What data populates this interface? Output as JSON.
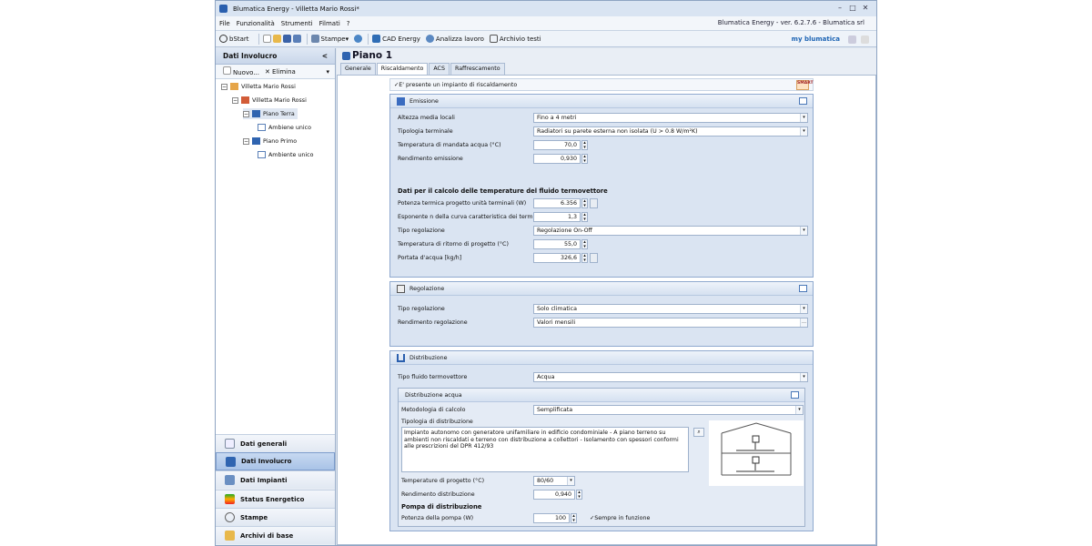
{
  "window": {
    "title": "Blumatica Energy - Villetta Mario Rossi*",
    "version": "Blumatica Energy - ver. 6.2.7.6 - Blumatica srl"
  },
  "menu": [
    "File",
    "Funzionalità",
    "Strumenti",
    "Filmati",
    "?"
  ],
  "toolbar": {
    "bstart": "bStart",
    "stampe": "Stampe",
    "cad": "CAD Energy",
    "analizza": "Analizza lavoro",
    "archivio": "Archivio testi",
    "brand": "my blumatica"
  },
  "left": {
    "header": "Dati Involucro",
    "collapse": "<",
    "nuovo": "Nuovo...",
    "elimina": "Elimina",
    "tree": [
      "Villetta Mario Rossi",
      "Villetta Mario Rossi",
      "Piano Terra",
      "Ambiene unico",
      "Piano Primo",
      "Ambiente unico"
    ],
    "nav": [
      "Dati generali",
      "Dati Involucro",
      "Dati Impianti",
      "Status Energetico",
      "Stampe",
      "Archivi di base"
    ]
  },
  "main": {
    "title": "Piano 1",
    "tabs": [
      "Generale",
      "Riscaldamento",
      "ACS",
      "Raffrescamento"
    ],
    "impianto_check": "E' presente un impianto di riscaldamento",
    "smart": "SMART",
    "emissione": {
      "title": "Emissione",
      "rows": [
        {
          "label": "Altezza media locali",
          "value": "Fino a 4 metri"
        },
        {
          "label": "Tipologia terminale",
          "value": "Radiatori su parete esterna non isolata (U > 0.8 W/m²K)"
        },
        {
          "label": "Temperatura di mandata acqua (°C)",
          "value": "70,0"
        },
        {
          "label": "Rendimento emissione",
          "value": "0,930"
        }
      ],
      "calc_title": "Dati per il calcolo delle temperature del fluido termovettore",
      "calc_rows": [
        {
          "label": "Potenza termica progetto unità terminali (W)",
          "value": "6.356"
        },
        {
          "label": "Esponente n della curva caratteristica dei terminali",
          "value": "1,3"
        },
        {
          "label": "Tipo regolazione",
          "value": "Regolazione On-Off"
        },
        {
          "label": "Temperatura di ritorno di progetto (°C)",
          "value": "55,0"
        },
        {
          "label": "Portata d'acqua [kg/h]",
          "value": "326,6"
        }
      ]
    },
    "regolazione": {
      "title": "Regolazione",
      "rows": [
        {
          "label": "Tipo regolazione",
          "value": "Solo climatica"
        },
        {
          "label": "Rendimento regolazione",
          "value": "Valori mensili"
        }
      ]
    },
    "distribuzione": {
      "title": "Distribuzione",
      "fluido_label": "Tipo fluido termovettore",
      "fluido": "Acqua",
      "acqua": {
        "title": "Distribuzione acqua",
        "metodo_label": "Metodologia di calcolo",
        "metodo": "Semplificata",
        "tipologia_label": "Tipologia di distribuzione",
        "tipologia": "Impianto autonomo con generatore unifamiliare in edificio condominiale - A piano terreno su ambienti non riscaldati e terreno con distribuzione a collettori - Isolamento con spessori conformi alle prescrizioni del DPR 412/93",
        "temp_label": "Temperature di progetto (°C)",
        "temp": "80/60",
        "rend_label": "Rendimento distribuzione",
        "rend": "0,940",
        "pompa_title": "Pompa di distribuzione",
        "pompa_label": "Potenza della pompa (W)",
        "pompa": "100",
        "sempre": "Sempre in funzione"
      }
    }
  }
}
